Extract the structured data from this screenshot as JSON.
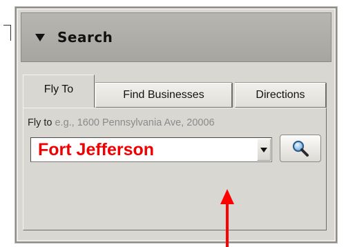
{
  "panel": {
    "title": "Search",
    "header_icon": "triangle-down-icon"
  },
  "tabs": [
    {
      "label": "Fly To",
      "active": true
    },
    {
      "label": "Find Businesses",
      "active": false
    },
    {
      "label": "Directions",
      "active": false
    }
  ],
  "fly_to": {
    "label": "Fly to",
    "example": "e.g., 1600 Pennsylvania Ave, 20006",
    "value": "Fort Jefferson",
    "value_color": "#f00000",
    "dropdown_icon": "chevron-down-icon",
    "search_icon": "magnifier-icon"
  },
  "annotation": {
    "arrow_color": "#ff0000",
    "arrow_icon": "arrow-up-icon"
  }
}
